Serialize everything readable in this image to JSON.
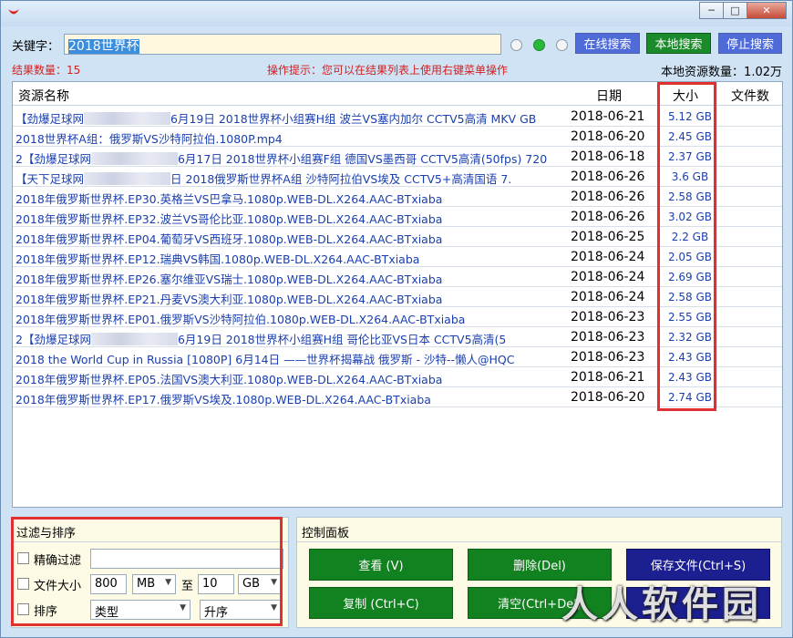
{
  "window": {
    "title": "",
    "controls": [
      "─",
      "□",
      "✕"
    ]
  },
  "search": {
    "keyword_label": "关键字：",
    "keyword_value": "2018世界杯",
    "online_search": "在线搜索",
    "local_search": "本地搜索",
    "stop_search": "停止搜索"
  },
  "info": {
    "result_count": "结果数量：15",
    "tip": "操作提示：您可以在结果列表上使用右键菜单操作",
    "local_count": "本地资源数量：1.02万"
  },
  "table": {
    "headers": {
      "name": "资源名称",
      "date": "日期",
      "size": "大小",
      "files": "文件数"
    },
    "rows": [
      {
        "pre": "【劲爆足球网",
        "blurred": true,
        "name": "6月19日 2018世界杯小组赛H组 波兰VS塞内加尔  CCTV5高清 MKV GB",
        "date": "2018-06-21",
        "size": "5.12 GB"
      },
      {
        "pre": "",
        "blurred": false,
        "name": "2018世界杯A组：俄罗斯VS沙特阿拉伯.1080P.mp4",
        "date": "2018-06-20",
        "size": "2.45 GB"
      },
      {
        "pre": "2【劲爆足球网",
        "blurred": true,
        "name": "6月17日 2018世界杯小组赛F组 德国VS墨西哥  CCTV5高清(50fps) 720",
        "date": "2018-06-18",
        "size": "2.37 GB"
      },
      {
        "pre": "【天下足球网",
        "blurred": true,
        "name": "日 2018俄罗斯世界杯A组 沙特阿拉伯VS埃及 CCTV5+高清国语 7.",
        "date": "2018-06-26",
        "size": "3.6 GB"
      },
      {
        "pre": "",
        "blurred": false,
        "name": "2018年俄罗斯世界杯.EP30.英格兰VS巴拿马.1080p.WEB-DL.X264.AAC-BTxiaba",
        "date": "2018-06-26",
        "size": "2.58 GB"
      },
      {
        "pre": "",
        "blurred": false,
        "name": "2018年俄罗斯世界杯.EP32.波兰VS哥伦比亚.1080p.WEB-DL.X264.AAC-BTxiaba",
        "date": "2018-06-26",
        "size": "3.02 GB"
      },
      {
        "pre": "",
        "blurred": false,
        "name": "2018年俄罗斯世界杯.EP04.葡萄牙VS西班牙.1080p.WEB-DL.X264.AAC-BTxiaba",
        "date": "2018-06-25",
        "size": "2.2 GB"
      },
      {
        "pre": "",
        "blurred": false,
        "name": "2018年俄罗斯世界杯.EP12.瑞典VS韩国.1080p.WEB-DL.X264.AAC-BTxiaba",
        "date": "2018-06-24",
        "size": "2.05 GB"
      },
      {
        "pre": "",
        "blurred": false,
        "name": "2018年俄罗斯世界杯.EP26.塞尔维亚VS瑞士.1080p.WEB-DL.X264.AAC-BTxiaba",
        "date": "2018-06-24",
        "size": "2.69 GB"
      },
      {
        "pre": "",
        "blurred": false,
        "name": "2018年俄罗斯世界杯.EP21.丹麦VS澳大利亚.1080p.WEB-DL.X264.AAC-BTxiaba",
        "date": "2018-06-24",
        "size": "2.58 GB"
      },
      {
        "pre": "",
        "blurred": false,
        "name": "2018年俄罗斯世界杯.EP01.俄罗斯VS沙特阿拉伯.1080p.WEB-DL.X264.AAC-BTxiaba",
        "date": "2018-06-23",
        "size": "2.55 GB"
      },
      {
        "pre": "2【劲爆足球网",
        "blurred": true,
        "name": "6月19日 2018世界杯小组赛H组 哥伦比亚VS日本 CCTV5高清(5",
        "date": "2018-06-23",
        "size": "2.32 GB"
      },
      {
        "pre": "",
        "blurred": false,
        "name": "2018 the World Cup in Russia [1080P]  6月14日 ——世界杯揭幕战 俄罗斯 - 沙特--懒人@HQC",
        "date": "2018-06-23",
        "size": "2.43 GB"
      },
      {
        "pre": "",
        "blurred": false,
        "name": "2018年俄罗斯世界杯.EP05.法国VS澳大利亚.1080p.WEB-DL.X264.AAC-BTxiaba",
        "date": "2018-06-21",
        "size": "2.43 GB"
      },
      {
        "pre": "",
        "blurred": false,
        "name": "2018年俄罗斯世界杯.EP17.俄罗斯VS埃及.1080p.WEB-DL.X264.AAC-BTxiaba",
        "date": "2018-06-20",
        "size": "2.74 GB"
      }
    ]
  },
  "filter": {
    "title": "过滤与排序",
    "exact_label": "精确过滤",
    "exact_value": "",
    "size_label": "文件大小",
    "size_min": "800",
    "size_min_unit": "MB",
    "to": "至",
    "size_max": "10",
    "size_max_unit": "GB",
    "sort_label": "排序",
    "sort_by": "类型",
    "sort_order": "升序"
  },
  "control": {
    "title": "控制面板",
    "view": "查看 (V)",
    "delete": "删除(Del)",
    "save": "保存文件(Ctrl+S)",
    "copy": "复制 (Ctrl+C)",
    "clear": "清空(Ctrl+Del)",
    "third": ""
  },
  "watermark": "人人软件园"
}
